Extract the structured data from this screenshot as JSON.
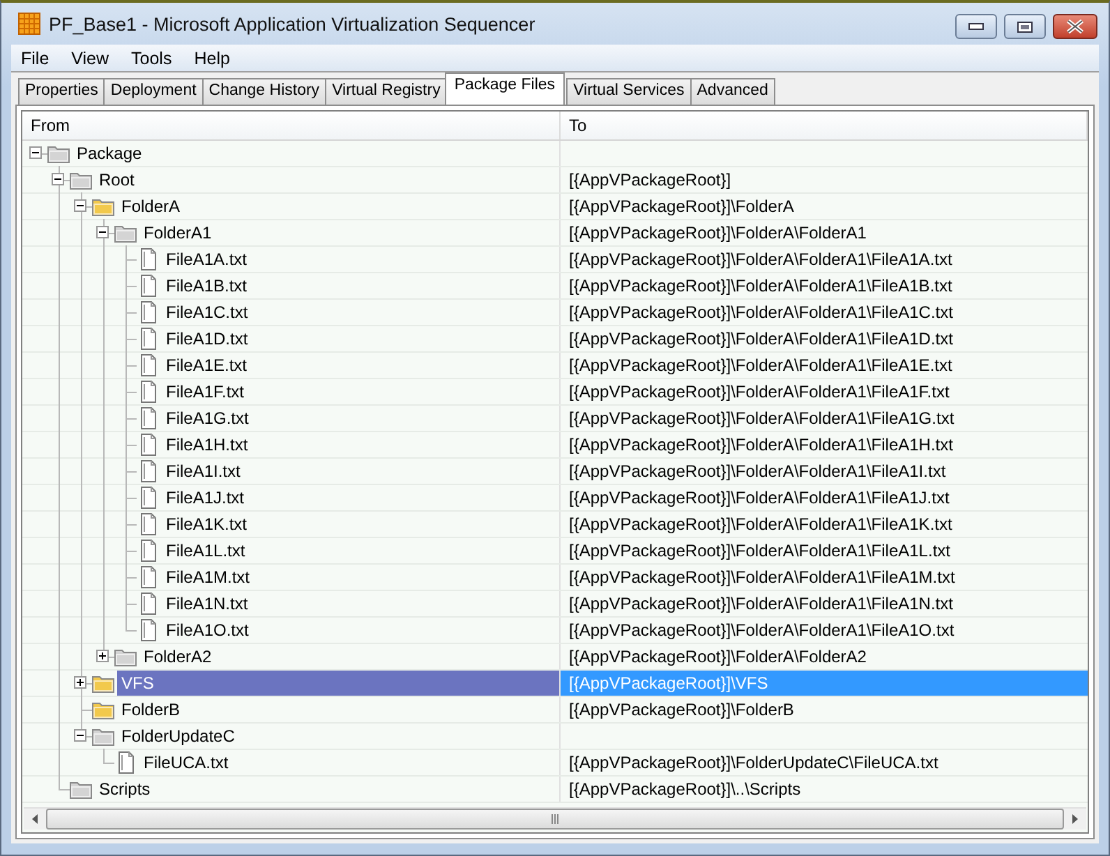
{
  "window": {
    "title": "PF_Base1 - Microsoft Application Virtualization Sequencer"
  },
  "menu": [
    "File",
    "View",
    "Tools",
    "Help"
  ],
  "tabs": [
    {
      "label": "Properties",
      "selected": false
    },
    {
      "label": "Deployment",
      "selected": false
    },
    {
      "label": "Change History",
      "selected": false
    },
    {
      "label": "Virtual Registry",
      "selected": false
    },
    {
      "label": "Package Files",
      "selected": true
    },
    {
      "label": "Virtual Services",
      "selected": false
    },
    {
      "label": "Advanced",
      "selected": false
    }
  ],
  "table": {
    "columns": [
      "From",
      "To"
    ],
    "tree": [
      {
        "kind": "folder",
        "name": "Package",
        "color": "#d4d4d4",
        "expanded": true,
        "selected": false,
        "children": [
          {
            "kind": "folder",
            "name": "Root",
            "target": "[{AppVPackageRoot}]",
            "color": "#d4d4d4",
            "expanded": true,
            "selected": false,
            "children": [
              {
                "kind": "folder",
                "name": "FolderA",
                "target": "[{AppVPackageRoot}]\\FolderA",
                "color": "#f2c94c",
                "expanded": true,
                "selected": false,
                "children": [
                  {
                    "kind": "folder",
                    "name": "FolderA1",
                    "target": "[{AppVPackageRoot}]\\FolderA\\FolderA1",
                    "color": "#d4d4d4",
                    "expanded": true,
                    "selected": false,
                    "children": [
                      {
                        "kind": "file",
                        "name": "FileA1A.txt",
                        "target": "[{AppVPackageRoot}]\\FolderA\\FolderA1\\FileA1A.txt",
                        "selected": false
                      },
                      {
                        "kind": "file",
                        "name": "FileA1B.txt",
                        "target": "[{AppVPackageRoot}]\\FolderA\\FolderA1\\FileA1B.txt",
                        "selected": false
                      },
                      {
                        "kind": "file",
                        "name": "FileA1C.txt",
                        "target": "[{AppVPackageRoot}]\\FolderA\\FolderA1\\FileA1C.txt",
                        "selected": false
                      },
                      {
                        "kind": "file",
                        "name": "FileA1D.txt",
                        "target": "[{AppVPackageRoot}]\\FolderA\\FolderA1\\FileA1D.txt",
                        "selected": false
                      },
                      {
                        "kind": "file",
                        "name": "FileA1E.txt",
                        "target": "[{AppVPackageRoot}]\\FolderA\\FolderA1\\FileA1E.txt",
                        "selected": false
                      },
                      {
                        "kind": "file",
                        "name": "FileA1F.txt",
                        "target": "[{AppVPackageRoot}]\\FolderA\\FolderA1\\FileA1F.txt",
                        "selected": false
                      },
                      {
                        "kind": "file",
                        "name": "FileA1G.txt",
                        "target": "[{AppVPackageRoot}]\\FolderA\\FolderA1\\FileA1G.txt",
                        "selected": false
                      },
                      {
                        "kind": "file",
                        "name": "FileA1H.txt",
                        "target": "[{AppVPackageRoot}]\\FolderA\\FolderA1\\FileA1H.txt",
                        "selected": false
                      },
                      {
                        "kind": "file",
                        "name": "FileA1I.txt",
                        "target": "[{AppVPackageRoot}]\\FolderA\\FolderA1\\FileA1I.txt",
                        "selected": false
                      },
                      {
                        "kind": "file",
                        "name": "FileA1J.txt",
                        "target": "[{AppVPackageRoot}]\\FolderA\\FolderA1\\FileA1J.txt",
                        "selected": false
                      },
                      {
                        "kind": "file",
                        "name": "FileA1K.txt",
                        "target": "[{AppVPackageRoot}]\\FolderA\\FolderA1\\FileA1K.txt",
                        "selected": false
                      },
                      {
                        "kind": "file",
                        "name": "FileA1L.txt",
                        "target": "[{AppVPackageRoot}]\\FolderA\\FolderA1\\FileA1L.txt",
                        "selected": false
                      },
                      {
                        "kind": "file",
                        "name": "FileA1M.txt",
                        "target": "[{AppVPackageRoot}]\\FolderA\\FolderA1\\FileA1M.txt",
                        "selected": false
                      },
                      {
                        "kind": "file",
                        "name": "FileA1N.txt",
                        "target": "[{AppVPackageRoot}]\\FolderA\\FolderA1\\FileA1N.txt",
                        "selected": false
                      },
                      {
                        "kind": "file",
                        "name": "FileA1O.txt",
                        "target": "[{AppVPackageRoot}]\\FolderA\\FolderA1\\FileA1O.txt",
                        "selected": false
                      }
                    ]
                  },
                  {
                    "kind": "folder",
                    "name": "FolderA2",
                    "target": "[{AppVPackageRoot}]\\FolderA\\FolderA2",
                    "color": "#d4d4d4",
                    "expanded": false,
                    "selected": false
                  }
                ]
              },
              {
                "kind": "folder",
                "name": "VFS",
                "target": "[{AppVPackageRoot}]\\VFS",
                "color": "#f2c94c",
                "expanded": false,
                "selected": true
              },
              {
                "kind": "folder",
                "name": "FolderB",
                "target": "[{AppVPackageRoot}]\\FolderB",
                "color": "#f2c94c",
                "selected": false
              },
              {
                "kind": "folder",
                "name": "FolderUpdateC",
                "color": "#d4d4d4",
                "expanded": true,
                "selected": false,
                "children": [
                  {
                    "kind": "file",
                    "name": "FileUCA.txt",
                    "target": "[{AppVPackageRoot}]\\FolderUpdateC\\FileUCA.txt",
                    "selected": false
                  }
                ]
              }
            ]
          },
          {
            "kind": "folder",
            "name": "Scripts",
            "target": "[{AppVPackageRoot}]\\..\\Scripts",
            "color": "#d4d4d4",
            "selected": false
          }
        ]
      }
    ]
  }
}
